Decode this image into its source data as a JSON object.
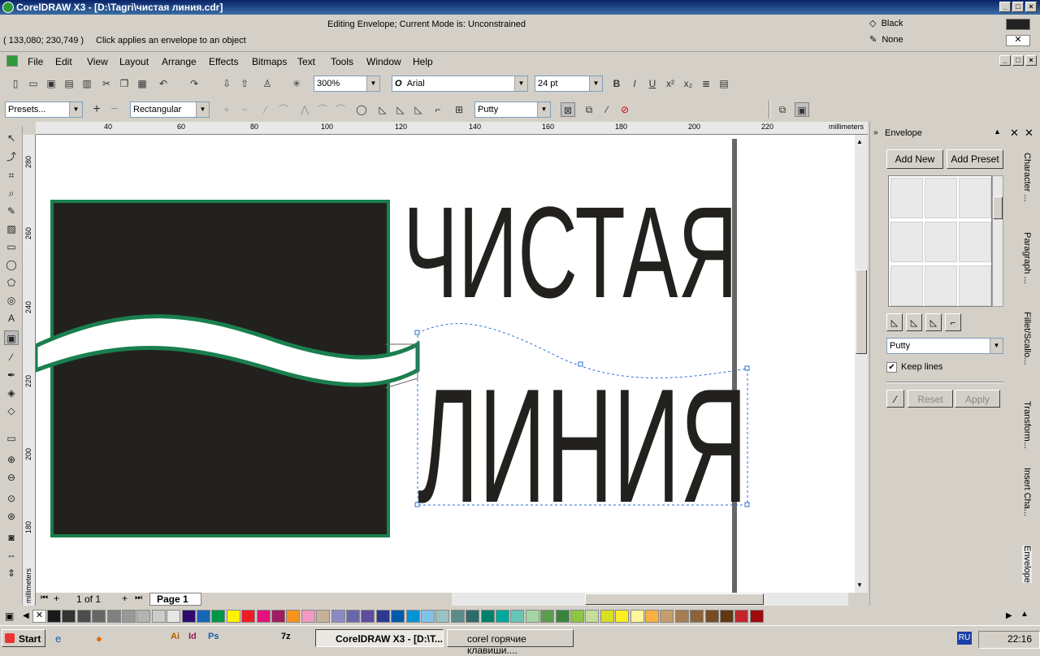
{
  "window": {
    "title": "CorelDRAW X3 - [D:\\Tagri\\чистая линия.cdr]"
  },
  "status": {
    "mode": "Editing Envelope;  Current Mode is: Unconstrained",
    "coords": "( 133,080; 230,749 )",
    "hint": "Click applies an envelope to an object",
    "fill_label": "Black",
    "outline_label": "None"
  },
  "menu": {
    "items": [
      "File",
      "Edit",
      "View",
      "Layout",
      "Arrange",
      "Effects",
      "Bitmaps",
      "Text",
      "Tools",
      "Window",
      "Help"
    ]
  },
  "toolbar": {
    "zoom": "300%",
    "font": "Arial",
    "font_size": "24 pt"
  },
  "propertybar": {
    "presets": "Presets...",
    "mode": "Rectangular",
    "mapping": "Putty"
  },
  "ruler": {
    "unit": "millimeters",
    "h_ticks": [
      "40",
      "60",
      "80",
      "100",
      "120",
      "140",
      "160",
      "180",
      "200",
      "220"
    ],
    "v_ticks": [
      "280",
      "260",
      "240",
      "220",
      "200",
      "180"
    ],
    "v_unit": "millimeters"
  },
  "canvas": {
    "text_line1": "ЧИСТАЯ",
    "text_line2": "ЛИНИЯ"
  },
  "pagenav": {
    "count": "1 of 1",
    "page": "Page 1"
  },
  "docker": {
    "title": "Envelope",
    "add_new": "Add New",
    "add_preset": "Add Preset",
    "mapping": "Putty",
    "keep_lines": "Keep lines",
    "reset": "Reset",
    "apply": "Apply",
    "tabs": [
      "Character ...",
      "Paragraph ...",
      "Fillet/Scallo...",
      "Transform...",
      "Insert Cha...",
      "Envelope"
    ]
  },
  "taskbar": {
    "start": "Start",
    "tasks": [
      "CorelDRAW X3 - [D:\\T...",
      "corel горячие клавиши...."
    ],
    "lang": "RU",
    "time": "22:16"
  },
  "palette_colors": [
    "#ffffff",
    "#1a1a1a",
    "#333333",
    "#4d4d4d",
    "#666666",
    "#808080",
    "#999999",
    "#b3b3b3",
    "#cccccc",
    "#e6e6e6",
    "#2e0a6e",
    "#1666b8",
    "#00964a",
    "#fff200",
    "#ee1d23",
    "#e3127a",
    "#a01d5f",
    "#f7941d",
    "#f49ac1",
    "#c7b299",
    "#8b89c3",
    "#6a68ad",
    "#5f4c9f",
    "#2b3990",
    "#005bab",
    "#0093d6",
    "#7fc4e8",
    "#9bc3c4",
    "#5c8a88",
    "#2e6b68",
    "#00806a",
    "#00a79d",
    "#67c7b7",
    "#a5d5a5",
    "#5b9c4f",
    "#39843a",
    "#8dc63f",
    "#c4df9b",
    "#d9e021",
    "#fcee21",
    "#fff799",
    "#fbb040",
    "#c69c6d",
    "#a67c52",
    "#8c6239",
    "#754c24",
    "#603813",
    "#c1272d",
    "#9e0b0f"
  ]
}
